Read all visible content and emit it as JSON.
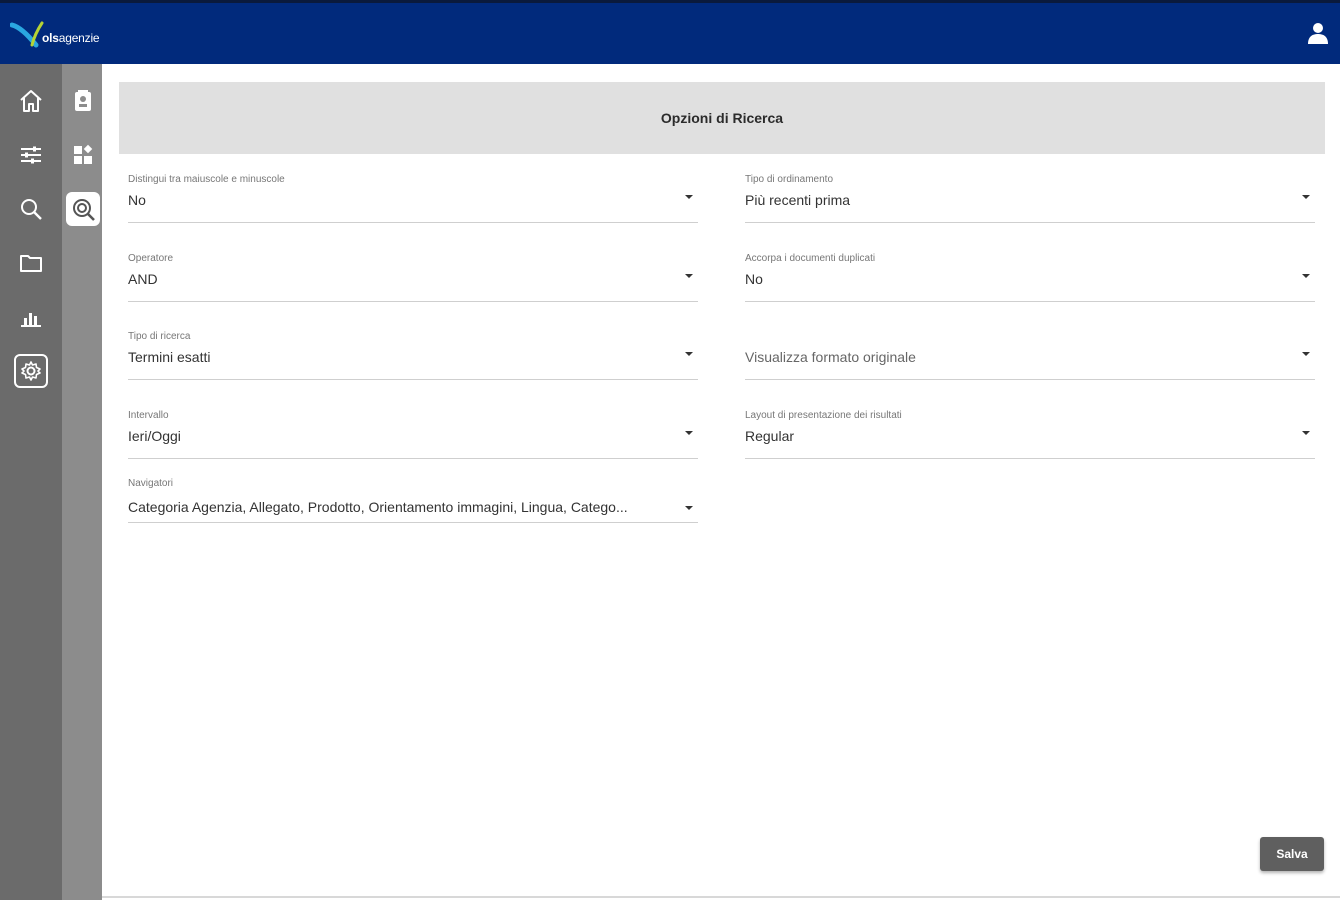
{
  "header": {
    "brand_bold": "ols",
    "brand_rest": "agenzie",
    "brand_color": "#012a7c"
  },
  "nav_primary": [
    {
      "icon": "home-icon",
      "active": false
    },
    {
      "icon": "filters-icon",
      "active": false
    },
    {
      "icon": "search-icon",
      "active": false
    },
    {
      "icon": "folder-icon",
      "active": false
    },
    {
      "icon": "chart-icon",
      "active": false
    },
    {
      "icon": "settings-icon",
      "active": false
    }
  ],
  "nav_secondary": [
    {
      "icon": "profile-card-icon",
      "active": false
    },
    {
      "icon": "widgets-icon",
      "active": false
    },
    {
      "icon": "search-options-icon",
      "active": true
    }
  ],
  "panel": {
    "title": "Opzioni di Ricerca"
  },
  "fields": {
    "case_sensitive": {
      "label": "Distingui tra maiuscole e minuscole",
      "value": "No"
    },
    "sort_type": {
      "label": "Tipo di ordinamento",
      "value": "Più recenti prima"
    },
    "operator": {
      "label": "Operatore",
      "value": "AND"
    },
    "merge_duplicates": {
      "label": "Accorpa i documenti duplicati",
      "value": "No"
    },
    "search_type": {
      "label": "Tipo di ricerca",
      "value": "Termini esatti"
    },
    "original_format": {
      "label": "",
      "value": "Visualizza formato originale"
    },
    "interval": {
      "label": "Intervallo",
      "value": "Ieri/Oggi"
    },
    "results_layout": {
      "label": "Layout di presentazione dei risultati",
      "value": "Regular"
    },
    "navigators": {
      "label": "Navigatori",
      "value": "Categoria Agenzia, Allegato, Prodotto, Orientamento immagini, Lingua, Catego..."
    }
  },
  "actions": {
    "save_label": "Salva"
  }
}
